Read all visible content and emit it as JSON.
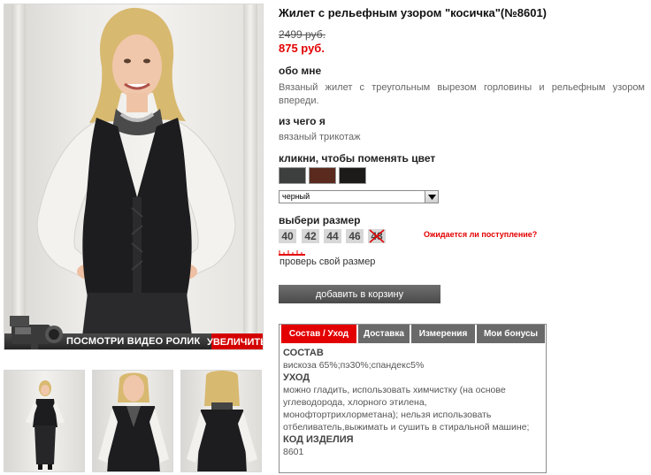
{
  "product": {
    "title": "Жилет с рельефным узором \"косичка\"(№8601)",
    "old_price": "2499 руб.",
    "new_price": "875 руб."
  },
  "about": {
    "heading": "обо мне",
    "text": "Вязаный жилет с треугольным вырезом горловины и рельефным узором впереди."
  },
  "material": {
    "heading": "из чего я",
    "text": "вязаный трикотаж"
  },
  "color": {
    "heading": "кликни, чтобы поменять цвет",
    "selected": "черный",
    "swatch_colors": [
      "#3c3f3e",
      "#5a2a1f",
      "#1c1b1a"
    ]
  },
  "size": {
    "heading": "выбери размер",
    "options": [
      "40",
      "42",
      "44",
      "46",
      "48"
    ],
    "unavailable": [
      "48"
    ],
    "expected_link": "Ожидается ли поступление?",
    "check_link": "проверь свой размер"
  },
  "cart": {
    "button_label": "добавить в корзину"
  },
  "media": {
    "video_label": "ПОСМОТРИ ВИДЕО РОЛИК",
    "zoom_label": "УВЕЛИЧИТЬ"
  },
  "tabs": {
    "items": [
      "Состав / Уход",
      "Доставка",
      "Измерения",
      "Мои бонусы"
    ],
    "active": "Состав / Уход",
    "content": {
      "composition_heading": "СОСТАВ",
      "composition_text": "вискоза 65%;пэ30%;спандекс5%",
      "care_heading": "УХОД",
      "care_text": "можно гладить, использовать химчистку (на основе углеводорода, хлорного этилена, монофтортрихлорметана); нельзя использовать отбеливатель,выжимать и сушить в стиральной машине;",
      "code_heading": "КОД ИЗДЕЛИЯ",
      "code_value": "8601"
    }
  },
  "colors": {
    "accent": "#e30000",
    "tab_inactive": "#6a6a6a",
    "button": "#555555"
  }
}
